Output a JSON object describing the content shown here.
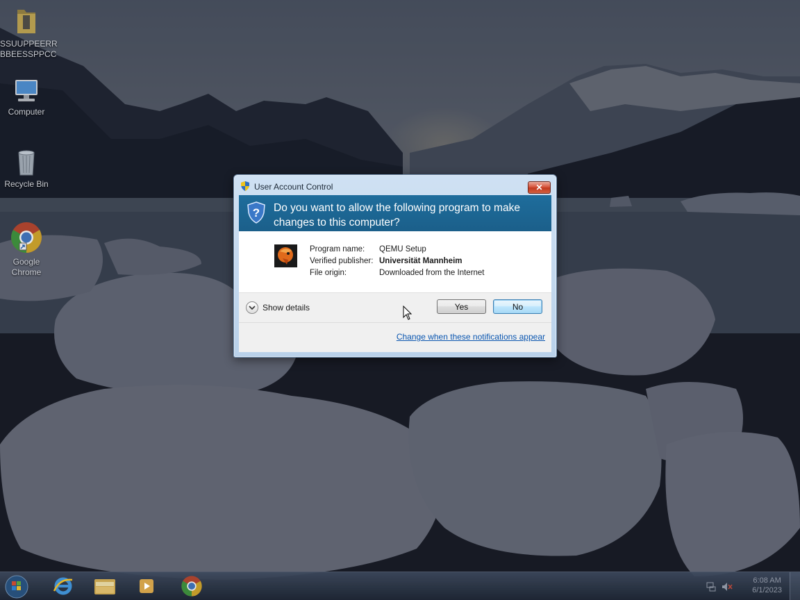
{
  "desktop": {
    "icons": [
      {
        "label": "SSUUPPEERR\nBBEESSPPCC",
        "line1": "SSUUPPEERR",
        "line2": "BBEESSPPCC",
        "icon": "folder-icon"
      },
      {
        "label": "Computer",
        "icon": "computer-icon"
      },
      {
        "label": "Recycle Bin",
        "icon": "recycle-bin-icon"
      },
      {
        "label": "Google Chrome",
        "line1": "Google",
        "line2": "Chrome",
        "icon": "chrome-icon"
      }
    ]
  },
  "dialog": {
    "title": "User Account Control",
    "close_label": "✕",
    "question": "Do you want to allow the following program to make changes to this computer?",
    "fields": [
      {
        "key": "Program name:",
        "value": "QEMU Setup"
      },
      {
        "key": "Verified publisher:",
        "value": "Universität Mannheim"
      },
      {
        "key": "File origin:",
        "value": "Downloaded from the Internet"
      }
    ],
    "show_details_label": "Show details",
    "yes_label": "Yes",
    "no_label": "No",
    "change_link": "Change when these notifications appear"
  },
  "taskbar": {
    "pinned": [
      "start-orb",
      "internet-explorer-icon",
      "windows-explorer-icon",
      "media-player-icon",
      "chrome-icon"
    ],
    "clock_time": "6:08 AM",
    "clock_date": "6/1/2023"
  },
  "colors": {
    "uac_header": "#1b5f8a",
    "link": "#0a56b0",
    "close_button": "#c23a20"
  }
}
